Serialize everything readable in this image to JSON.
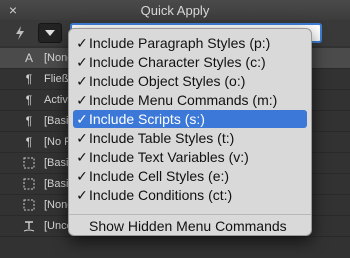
{
  "window": {
    "title": "Quick Apply",
    "close_icon": "close-icon"
  },
  "toolbar": {
    "lightning_icon": "lightning-icon",
    "dropdown_icon": "triangle-down-icon",
    "search_value": ""
  },
  "list": {
    "rows": [
      {
        "icon": "text-A-icon",
        "label": "[None]"
      },
      {
        "icon": "pilcrow-icon",
        "label": "Fließ"
      },
      {
        "icon": "pilcrow-icon",
        "label": "Active"
      },
      {
        "icon": "pilcrow-icon",
        "label": "[Basic"
      },
      {
        "icon": "pilcrow-icon",
        "label": "[No Pa"
      },
      {
        "icon": "object-frame-icon",
        "label": "[Basic"
      },
      {
        "icon": "object-frame-icon",
        "label": "[Basic"
      },
      {
        "icon": "object-frame-icon",
        "label": "[None]"
      },
      {
        "icon": "conditional-text-icon",
        "label": "[Unconditional]"
      }
    ]
  },
  "menu": {
    "items": [
      {
        "label": "Include Paragraph Styles (p:)",
        "checked": true
      },
      {
        "label": "Include Character Styles (c:)",
        "checked": true
      },
      {
        "label": "Include Object Styles (o:)",
        "checked": true
      },
      {
        "label": "Include Menu Commands (m:)",
        "checked": true
      },
      {
        "label": "Include Scripts (s:)",
        "checked": true,
        "highlighted": true
      },
      {
        "label": "Include Table Styles (t:)",
        "checked": true
      },
      {
        "label": "Include Text Variables (v:)",
        "checked": true
      },
      {
        "label": "Include Cell Styles (e:)",
        "checked": true
      },
      {
        "label": "Include Conditions (ct:)",
        "checked": true
      }
    ],
    "footer_item": "Show Hidden Menu Commands",
    "check_glyph": "✓"
  }
}
